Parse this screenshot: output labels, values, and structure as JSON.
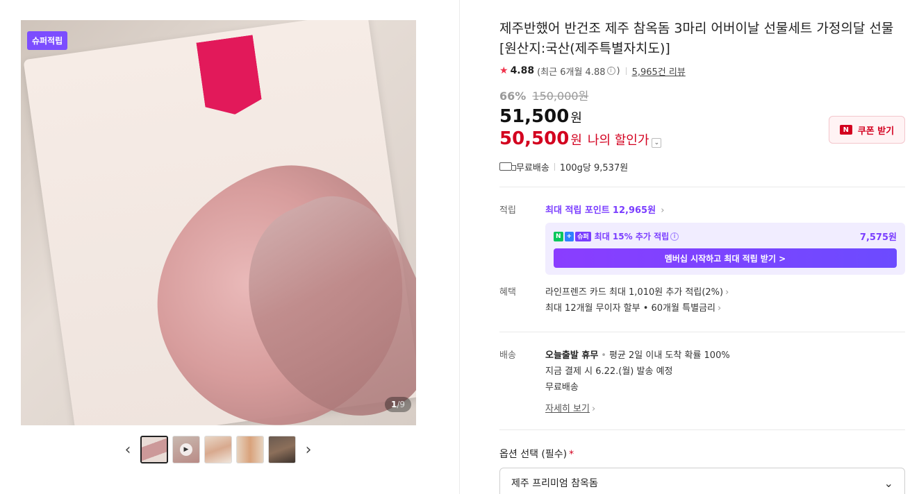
{
  "gallery": {
    "badge": "슈퍼적립",
    "counter_current": "1",
    "counter_total": "/9",
    "prev_icon": "chevron-left-icon",
    "next_icon": "chevron-right-icon",
    "thumb_count": 5
  },
  "product": {
    "title": "제주반했어 반건조 제주 참옥돔 3마리 어버이날 선물세트 가정의달 선물 [원산지:국산(제주특별자치도)]",
    "rating": "4.88",
    "recent_rating": "(최근 6개월 4.88",
    "recent_rating_close": ")",
    "reviews": "5,965건 리뷰",
    "discount_pct": "66%",
    "original_price": "150,000원",
    "price": "51,500",
    "price_unit": "원",
    "my_price": "50,500",
    "my_price_unit": "원",
    "my_price_label": "나의 할인가",
    "coupon_button": "쿠폰 받기",
    "coupon_icon_text": "N",
    "free_shipping": "무료배송",
    "unit_price": "100g당 9,537원"
  },
  "points": {
    "label": "적립",
    "max_points_text": "최대 적립 포인트",
    "max_points_amount": "12,965원",
    "membership_chip_n": "N",
    "membership_chip_plus": "+",
    "membership_chip_super": "슈퍼",
    "membership_text": "최대 15% 추가 적립",
    "membership_amount": "7,575원",
    "membership_button": "멤버십 시작하고 최대 적립 받기 >"
  },
  "benefits": {
    "label": "혜택",
    "lines": [
      "라인프렌즈 카드 최대 1,010원 추가 적립(2%)",
      "최대 12개월 무이자 할부 • 60개월 특별금리"
    ]
  },
  "shipping": {
    "label": "배송",
    "today": "오늘출발 휴무",
    "today_detail": "평균 2일 이내 도착 확률 100%",
    "schedule": "지금 결제 시 6.22.(월) 발송 예정",
    "fee": "무료배송",
    "more": "자세히 보기"
  },
  "option": {
    "label": "옵션 선택 (필수)",
    "required_mark": "*",
    "selected": "제주 프리미엄 참옥돔"
  },
  "colors": {
    "accent_red": "#d3001f",
    "accent_purple": "#7a3dff",
    "badge_purple": "#7c4dff"
  }
}
